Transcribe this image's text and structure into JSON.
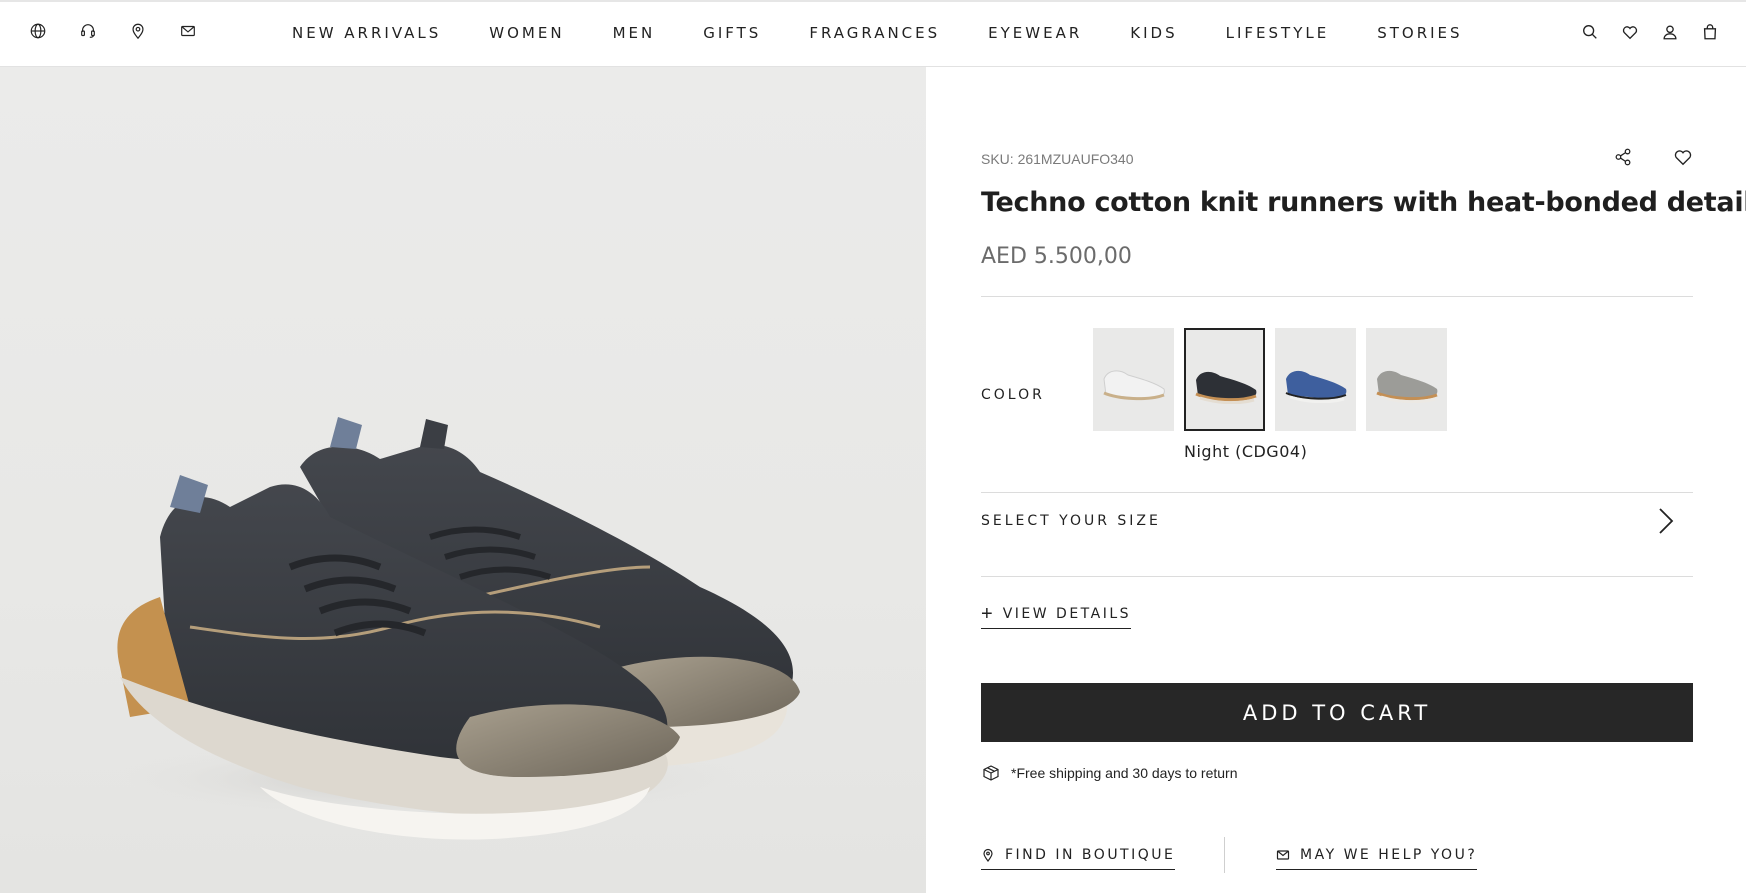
{
  "header": {
    "utility_icons": [
      "globe-icon",
      "headset-icon",
      "location-pin-icon",
      "mail-icon"
    ],
    "nav": [
      "NEW ARRIVALS",
      "WOMEN",
      "MEN",
      "GIFTS",
      "FRAGRANCES",
      "EYEWEAR",
      "KIDS",
      "LIFESTYLE",
      "STORIES"
    ],
    "action_icons": [
      "search-icon",
      "heart-icon",
      "user-icon",
      "bag-icon"
    ]
  },
  "product": {
    "sku": "SKU: 261MZUAUFO340",
    "title": "Techno cotton knit runners with heat-bonded details",
    "price": "AED 5.500,00",
    "color_label": "COLOR",
    "color_selected": "Night (CDG04)",
    "swatches": [
      {
        "name": "white",
        "upper": "#f2f2f2",
        "sole": "#e9e6e0",
        "accent": "#c9b08a"
      },
      {
        "name": "night",
        "upper": "#2d3036",
        "sole": "#e4ddd2",
        "accent": "#c48f54"
      },
      {
        "name": "blue",
        "upper": "#3e5f9e",
        "sole": "#f1f1ef",
        "accent": "#222222"
      },
      {
        "name": "grey",
        "upper": "#9c9c98",
        "sole": "#ece9e4",
        "accent": "#c48f54"
      }
    ],
    "size_label": "SELECT YOUR SIZE",
    "view_details": "VIEW DETAILS",
    "add_to_cart": "ADD TO CART",
    "shipping_note": "*Free shipping and 30 days to return",
    "find_in_boutique": "FIND IN BOUTIQUE",
    "may_we_help": "MAY WE HELP YOU?"
  },
  "colors": {
    "cart_bg": "#272727",
    "shoe_upper": "#3a3d43",
    "shoe_sole": "#ddd8cf",
    "shoe_toe": "#8d8576",
    "shoe_heel": "#c4914f"
  }
}
